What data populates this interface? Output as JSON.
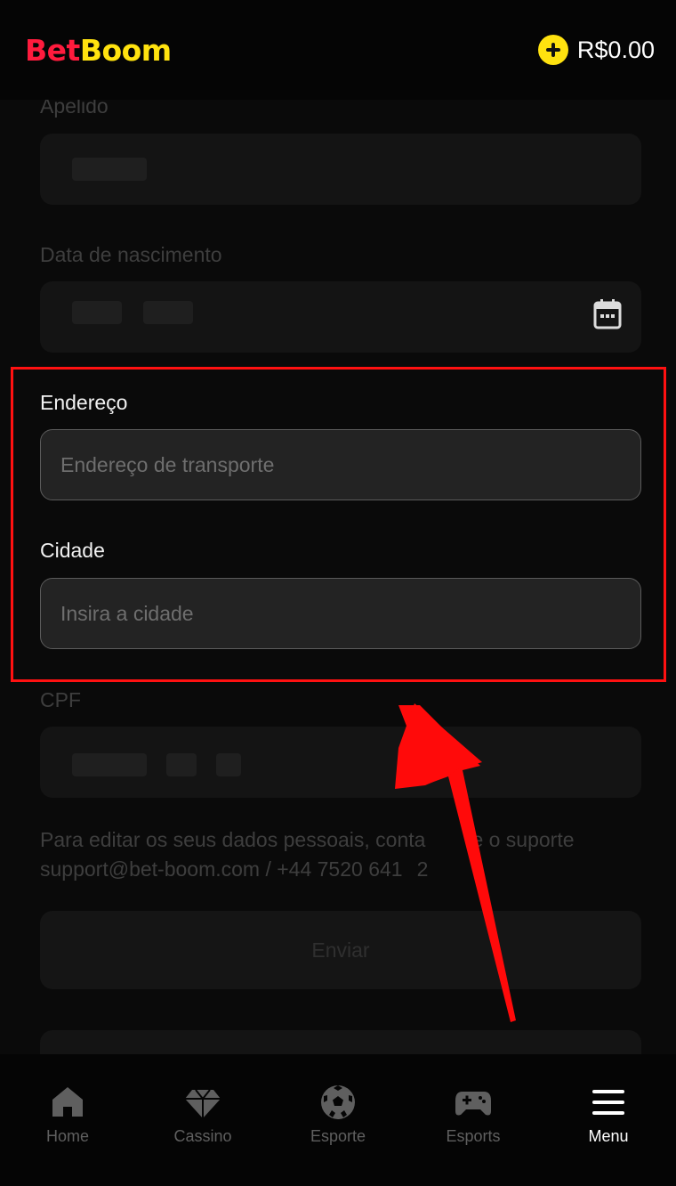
{
  "header": {
    "brand_part1": "Bet",
    "brand_part2": "Boom",
    "balance": "R$0.00"
  },
  "form": {
    "nickname_label": "Apelido",
    "birthdate_label": "Data de nascimento",
    "address_label": "Endereço",
    "address_placeholder": "Endereço de transporte",
    "city_label": "Cidade",
    "city_placeholder": "Insira a cidade",
    "cpf_label": "CPF",
    "support_line1": "Para editar os seus dados pessoais, conta",
    "support_line1_tail": "e o suporte",
    "support_line2": "support@bet-boom.com / +44 7520 641",
    "support_line2_tail": "2",
    "submit_label": "Enviar"
  },
  "nav": {
    "items": [
      {
        "label": "Home",
        "icon": "home-icon"
      },
      {
        "label": "Cassino",
        "icon": "diamond-icon"
      },
      {
        "label": "Esporte",
        "icon": "soccer-ball-icon"
      },
      {
        "label": "Esports",
        "icon": "gamepad-icon"
      },
      {
        "label": "Menu",
        "icon": "hamburger-icon"
      }
    ],
    "active": "Menu"
  },
  "colors": {
    "brand_red": "#ff1b3d",
    "brand_yellow": "#ffe20f",
    "highlight": "#ff1111",
    "background": "#0a0a0a"
  }
}
